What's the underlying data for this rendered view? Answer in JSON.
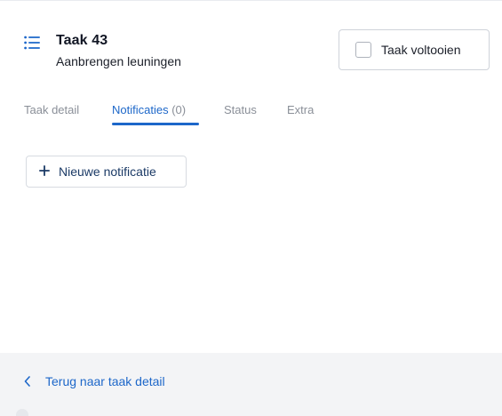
{
  "header": {
    "title": "Taak 43",
    "subtitle": "Aanbrengen leuningen",
    "icon": "list-icon",
    "complete_label": "Taak voltooien",
    "complete_checked": false
  },
  "tabs": [
    {
      "label": "Taak detail",
      "active": false
    },
    {
      "label": "Notificaties",
      "count": "(0)",
      "active": true
    },
    {
      "label": "Status",
      "active": false
    },
    {
      "label": "Extra",
      "active": false
    }
  ],
  "actions": {
    "new_notification_label": "Nieuwe notificatie",
    "new_icon": "plus-icon"
  },
  "footer": {
    "back_label": "Terug naar taak detail",
    "back_icon": "chevron-left-icon"
  },
  "colors": {
    "accent": "#1d67c9",
    "footer_bg": "#f3f4f6",
    "muted_text": "#8a8f98"
  }
}
